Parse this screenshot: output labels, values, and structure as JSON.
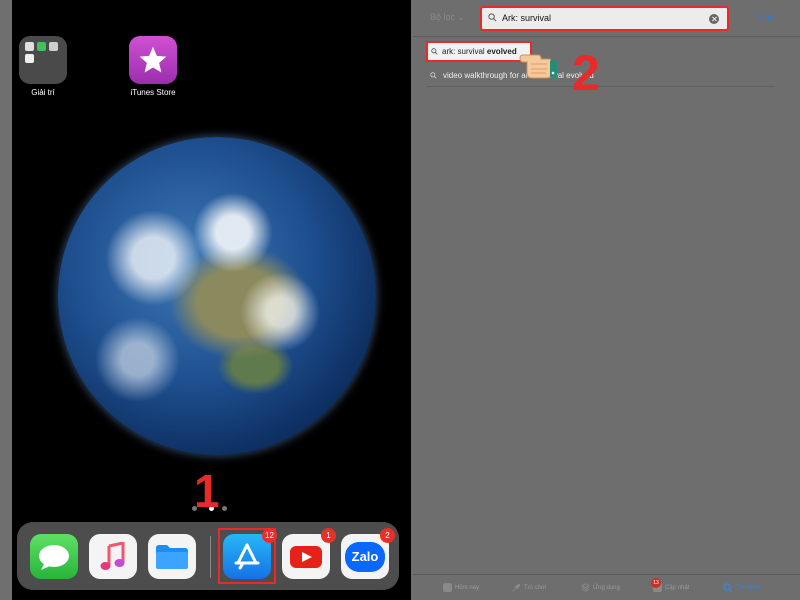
{
  "home": {
    "folder_label": "Giải trí",
    "itunes_label": "iTunes Store",
    "step_marker": "1",
    "dock": {
      "appstore_badge": "12",
      "youtube_badge": "1",
      "zalo_badge": "2",
      "zalo_text": "Zalo"
    }
  },
  "store": {
    "filter_label": "Bộ lọc",
    "search_value": "Ark: survival",
    "cancel_label": "Hủy",
    "suggestions": [
      {
        "prefix": "ark: survival ",
        "bold": "evolved"
      },
      {
        "prefix": "video walkthrough for ark: survival evolved",
        "bold": ""
      }
    ],
    "step_marker": "2",
    "tabs": [
      {
        "label": "Hôm nay"
      },
      {
        "label": "Trò chơi"
      },
      {
        "label": "Ứng dụng"
      },
      {
        "label": "Cập nhật",
        "badge": "13"
      },
      {
        "label": "Tìm kiếm"
      }
    ]
  },
  "colors": {
    "highlight_red": "#e82a2a",
    "link_blue": "#2d7bd4"
  }
}
